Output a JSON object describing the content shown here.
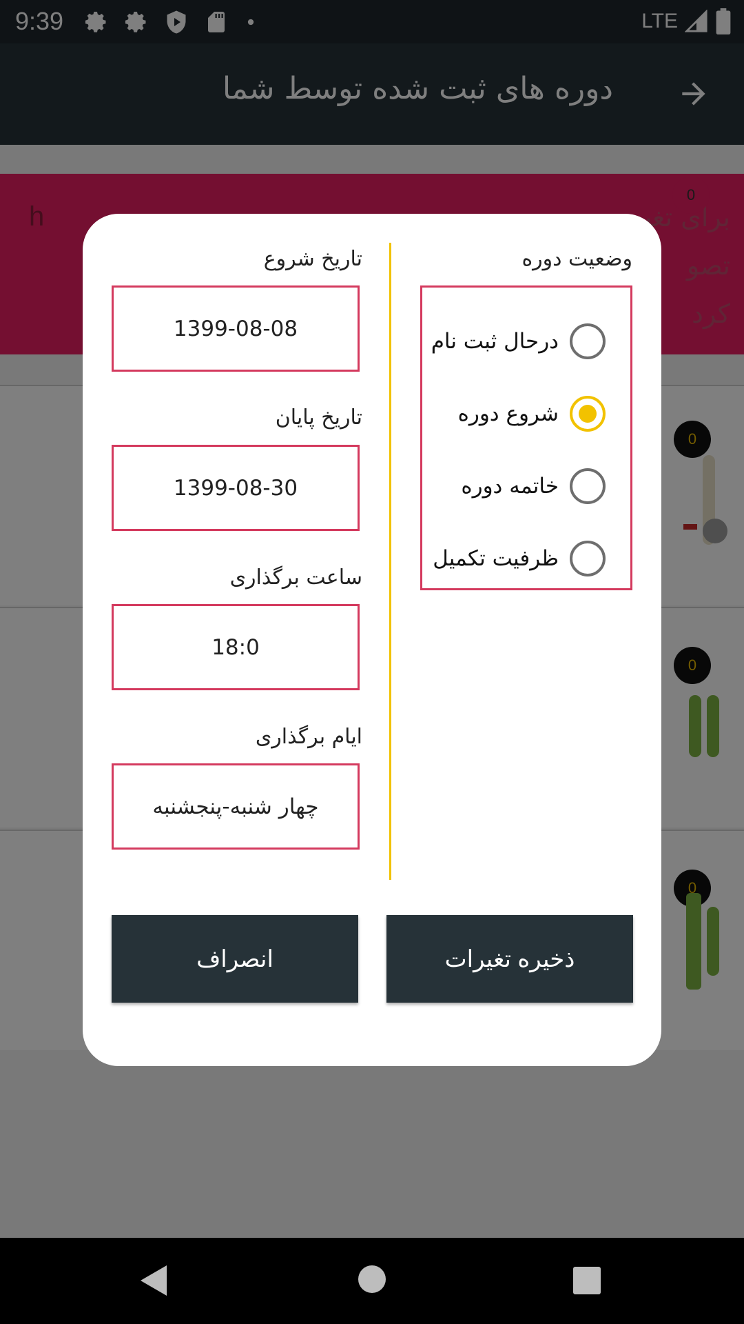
{
  "status_bar": {
    "time": "9:39",
    "network": "LTE",
    "icons": [
      "settings-icon",
      "settings-icon",
      "shield-icon",
      "sd-card-icon",
      "notification-dot-icon",
      "signal-icon",
      "battery-icon"
    ]
  },
  "app_bar": {
    "title": "دوره های ثبت شده توسط شما",
    "back_icon": "arrow-right-icon"
  },
  "background": {
    "card_letter": "h",
    "card_promo": [
      "برای تغیر",
      "تصو",
      "کرد"
    ],
    "badges": [
      "0",
      "0",
      "0",
      "0"
    ]
  },
  "dialog": {
    "status_title": "وضعیت دوره",
    "status_options": [
      {
        "label": "درحال ثبت نام",
        "selected": false
      },
      {
        "label": "شروع دوره",
        "selected": true
      },
      {
        "label": "خاتمه دوره",
        "selected": false
      },
      {
        "label": "ظرفیت تکمیل",
        "selected": false
      }
    ],
    "fields": [
      {
        "label": "تاریخ شروع",
        "value": "1399-08-08"
      },
      {
        "label": "تاریخ پایان",
        "value": "1399-08-30"
      },
      {
        "label": "ساعت برگذاری",
        "value": "18:0"
      },
      {
        "label": "ایام برگذاری",
        "value": "چهار شنبه-پنجشنبه"
      }
    ],
    "save_label": "ذخیره تغیرات",
    "cancel_label": "انصراف"
  },
  "colors": {
    "accent": "#f2c200",
    "field_border": "#d43a5e",
    "dark": "#263238",
    "card": "#e91e63"
  }
}
